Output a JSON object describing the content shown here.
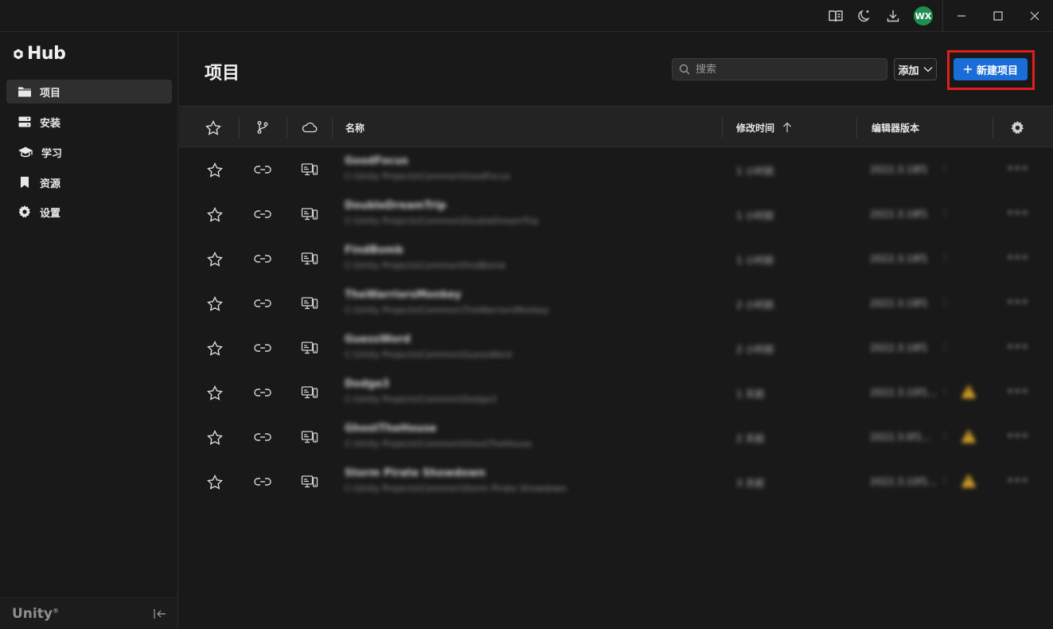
{
  "titlebar": {
    "avatar_initials": "WX",
    "icons": [
      "book-icon",
      "moon-icon",
      "download-icon"
    ],
    "window_controls": [
      "minimize-icon",
      "maximize-icon",
      "close-icon"
    ]
  },
  "sidebar": {
    "logo": "Hub",
    "items": [
      {
        "label": "项目",
        "icon": "folder-icon",
        "active": true
      },
      {
        "label": "安装",
        "icon": "server-icon",
        "active": false
      },
      {
        "label": "学习",
        "icon": "graduation-cap-icon",
        "active": false
      },
      {
        "label": "资源",
        "icon": "bookmark-icon",
        "active": false
      },
      {
        "label": "设置",
        "icon": "gear-icon",
        "active": false
      }
    ],
    "footer_brand": "Unity",
    "footer_brand_mark": "®"
  },
  "header": {
    "title": "项目",
    "search_placeholder": "搜索",
    "add_label": "添加",
    "new_project_label": "新建项目",
    "accent_color": "#1a6dd6",
    "highlight_color": "#e31d1d"
  },
  "table": {
    "columns": {
      "name": "名称",
      "modified": "修改时间",
      "editor_version": "编辑器版本"
    },
    "rows": [
      {
        "name": "GoodFocus",
        "path": "C:\\Unity Projects\\Common\\GoodFocus",
        "modified": "1 小时前",
        "version": "2022.3.18f1",
        "warning": false
      },
      {
        "name": "DoubleDreamTrip",
        "path": "C:\\Unity Projects\\Common\\DoubleDreamTrip",
        "modified": "1 小时前",
        "version": "2022.3.18f1",
        "warning": false
      },
      {
        "name": "FindBomb",
        "path": "C:\\Unity Projects\\Common\\FindBomb",
        "modified": "1 小时前",
        "version": "2022.3.18f1",
        "warning": false
      },
      {
        "name": "TheWarriorsMonkey",
        "path": "C:\\Unity Projects\\Common\\TheWarriorsMonkey",
        "modified": "2 小时前",
        "version": "2022.3.18f1",
        "warning": false
      },
      {
        "name": "GuessWord",
        "path": "C:\\Unity Projects\\Common\\GuessWord",
        "modified": "2 小时前",
        "version": "2022.3.18f1",
        "warning": false
      },
      {
        "name": "Dodge3",
        "path": "C:\\Unity Projects\\Common\\Dodge3",
        "modified": "1 天前",
        "version": "2022.3.10f1...",
        "warning": true
      },
      {
        "name": "GhostTheHouse",
        "path": "C:\\Unity Projects\\Common\\GhostTheHouse",
        "modified": "2 天前",
        "version": "2022.3.0f1...",
        "warning": true
      },
      {
        "name": "Storm Pirate Showdown",
        "path": "C:\\Unity Projects\\Common\\Storm Pirate Showdown",
        "modified": "3 天前",
        "version": "2022.3.10f1...",
        "warning": true
      }
    ]
  }
}
